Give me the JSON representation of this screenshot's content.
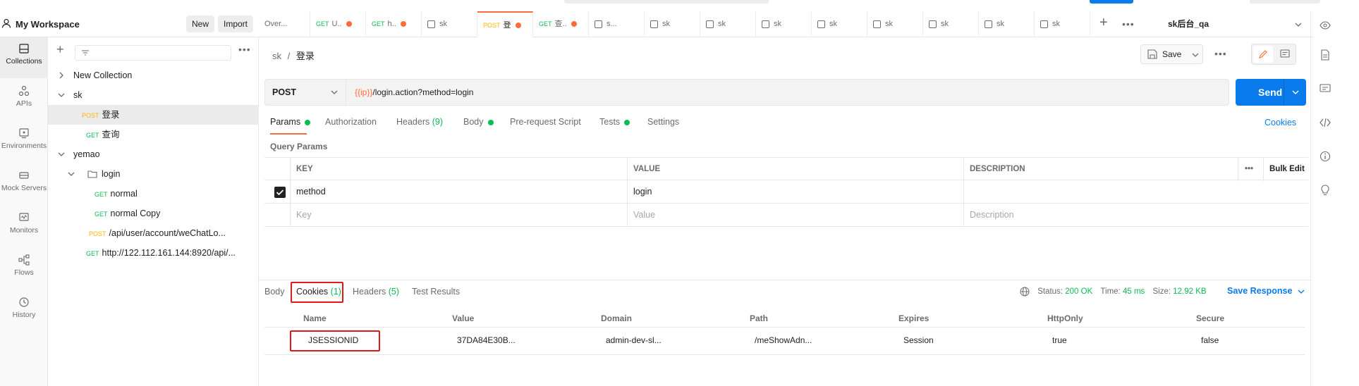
{
  "workspace": {
    "title": "My Workspace",
    "new_label": "New",
    "import_label": "Import"
  },
  "rail": [
    {
      "label": "Collections",
      "icon": "collections-icon"
    },
    {
      "label": "APIs",
      "icon": "apis-icon"
    },
    {
      "label": "Environments",
      "icon": "environments-icon"
    },
    {
      "label": "Mock Servers",
      "icon": "mock-servers-icon"
    },
    {
      "label": "Monitors",
      "icon": "monitors-icon"
    },
    {
      "label": "Flows",
      "icon": "flows-icon"
    },
    {
      "label": "History",
      "icon": "history-icon"
    }
  ],
  "tree": [
    {
      "label": "New Collection",
      "method": "",
      "indent": 0
    },
    {
      "label": "sk",
      "method": "",
      "indent": 0
    },
    {
      "label": "登录",
      "method": "POST",
      "indent": 1
    },
    {
      "label": "查询",
      "method": "GET",
      "indent": 1
    },
    {
      "label": "yemao",
      "method": "",
      "indent": 0
    },
    {
      "label": "login",
      "method": "",
      "indent": 1
    },
    {
      "label": "normal",
      "method": "GET",
      "indent": 2
    },
    {
      "label": "normal Copy",
      "method": "GET",
      "indent": 2
    },
    {
      "label": "/api/user/account/weChatLo...",
      "method": "POST",
      "indent": 1
    },
    {
      "label": "http://122.112.161.144:8920/api/...",
      "method": "GET",
      "indent": 1
    }
  ],
  "tabs": [
    {
      "method": "",
      "label": "Over...",
      "dot": false
    },
    {
      "method": "GET",
      "label": "U..",
      "dot": true
    },
    {
      "method": "GET",
      "label": "h..",
      "dot": true
    },
    {
      "method": "",
      "label": "sk",
      "dot": false
    },
    {
      "method": "POST",
      "label": "登",
      "dot": true
    },
    {
      "method": "GET",
      "label": "查..",
      "dot": true
    },
    {
      "method": "",
      "label": "s...",
      "dot": false
    },
    {
      "method": "",
      "label": "sk",
      "dot": false
    },
    {
      "method": "",
      "label": "sk",
      "dot": false
    },
    {
      "method": "",
      "label": "sk",
      "dot": false
    },
    {
      "method": "",
      "label": "sk",
      "dot": false
    },
    {
      "method": "",
      "label": "sk",
      "dot": false
    },
    {
      "method": "",
      "label": "sk",
      "dot": false
    },
    {
      "method": "",
      "label": "sk",
      "dot": false
    },
    {
      "method": "",
      "label": "sk",
      "dot": false
    }
  ],
  "environment": "sk后台_qa",
  "breadcrumb": {
    "parent": "sk",
    "sep": "/",
    "current": "登录"
  },
  "save_label": "Save",
  "request": {
    "method": "POST",
    "url_var": "{{ip}}",
    "url_rest": "/login.action?method=login",
    "send_label": "Send"
  },
  "req_tabs": {
    "params": "Params",
    "authorization": "Authorization",
    "headers": "Headers",
    "headers_count": "(9)",
    "body": "Body",
    "prerequest": "Pre-request Script",
    "tests": "Tests",
    "settings": "Settings",
    "cookies": "Cookies"
  },
  "query_params_label": "Query Params",
  "params_table": {
    "headers": {
      "key": "KEY",
      "value": "VALUE",
      "description": "DESCRIPTION",
      "bulk_edit": "Bulk Edit"
    },
    "rows": [
      {
        "key": "method",
        "value": "login",
        "description": ""
      }
    ],
    "placeholder": {
      "key": "Key",
      "value": "Value",
      "description": "Description"
    }
  },
  "response": {
    "tabs": {
      "body": "Body",
      "cookies": "Cookies",
      "cookies_count": "(1)",
      "headers": "Headers",
      "headers_count": "(5)",
      "test_results": "Test Results"
    },
    "status_label": "Status:",
    "status_value": "200 OK",
    "time_label": "Time:",
    "time_value": "45 ms",
    "size_label": "Size:",
    "size_value": "12.92 KB",
    "save_response": "Save Response",
    "cookie_headers": [
      "Name",
      "Value",
      "Domain",
      "Path",
      "Expires",
      "HttpOnly",
      "Secure"
    ],
    "cookies": [
      {
        "name": "JSESSIONID",
        "value": "37DA84E30B...",
        "domain": "admin-dev-sl...",
        "path": "/meShowAdn...",
        "expires": "Session",
        "httponly": "true",
        "secure": "false"
      }
    ]
  },
  "colors": {
    "accent": "#ff6c37",
    "primary": "#097bed",
    "success": "#0cbb52",
    "post": "#ffb400",
    "highlight": "#e01818"
  }
}
